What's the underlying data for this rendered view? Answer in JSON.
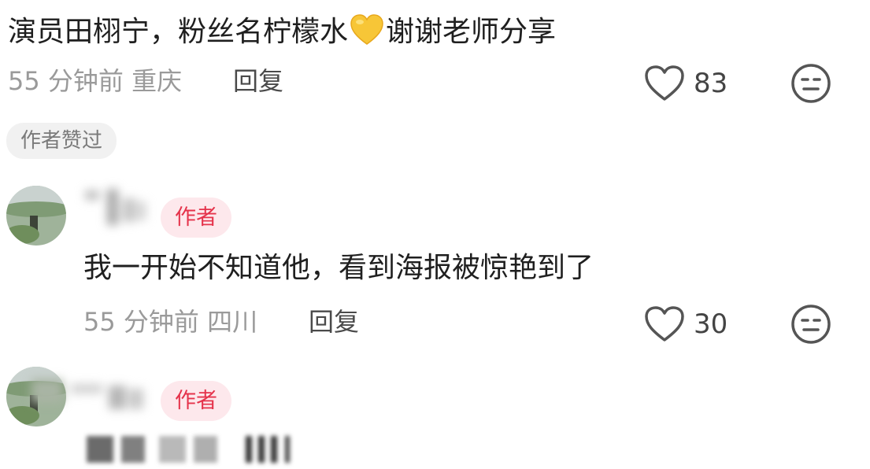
{
  "comment1": {
    "text_before": "演员田栩宁，粉丝名柠檬水",
    "emoji": "yellow-heart-emoji",
    "text_after": "谢谢老师分享",
    "meta": "55 分钟前 重庆",
    "reply_label": "回复",
    "like_count": "83",
    "badge": "作者赞过"
  },
  "comment2": {
    "author_tag": "作者",
    "text": "我一开始不知道他，看到海报被惊艳到了",
    "meta": "55 分钟前 四川",
    "reply_label": "回复",
    "like_count": "30"
  },
  "comment3": {
    "author_tag": "作者"
  },
  "colors": {
    "author_tag_bg": "#fde8ec",
    "author_tag_text": "#e5334b",
    "meta_gray": "#9a9a9a",
    "emoji_yellow": "#f7c637"
  }
}
